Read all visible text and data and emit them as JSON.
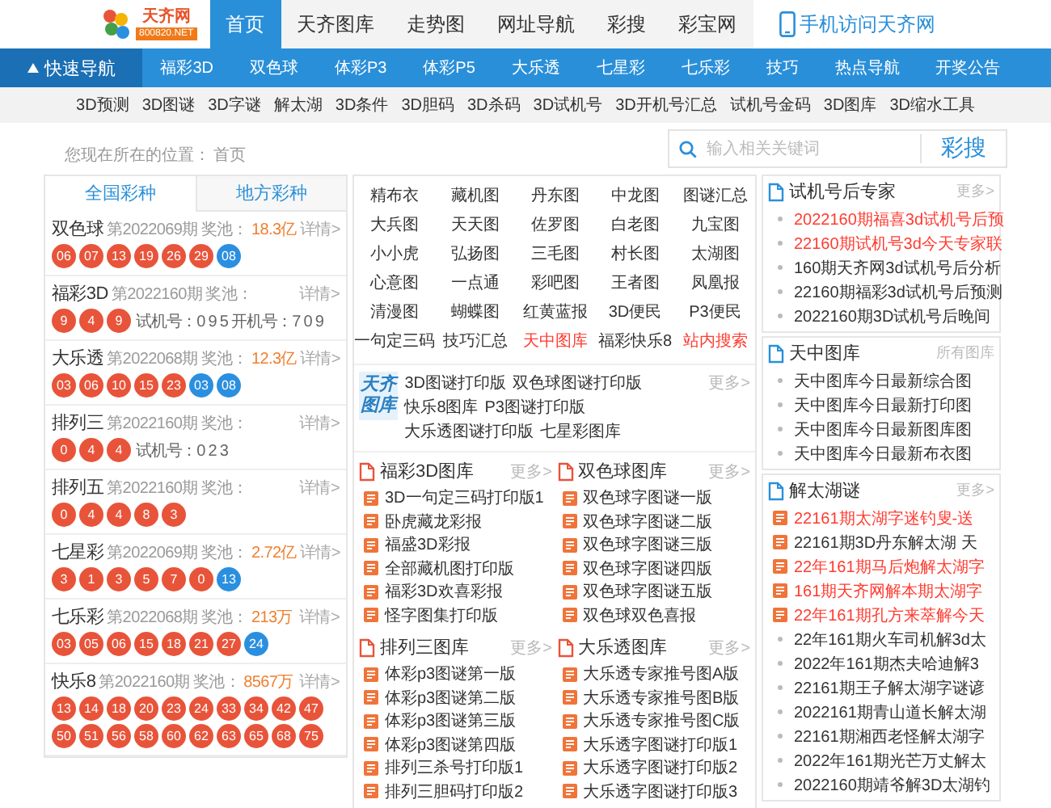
{
  "header": {
    "logo": {
      "name": "天齐网",
      "domain": "800820.NET"
    },
    "tabs": [
      {
        "label": "首页",
        "selected": true
      },
      {
        "label": "天齐图库",
        "selected": false
      },
      {
        "label": "走势图",
        "selected": false
      },
      {
        "label": "网址导航",
        "selected": false
      },
      {
        "label": "彩搜",
        "selected": false
      },
      {
        "label": "彩宝网",
        "selected": false
      }
    ],
    "mobile_link": "手机访问天齐网"
  },
  "quick_nav": {
    "label": "快速导航",
    "items": [
      "福彩3D",
      "双色球",
      "体彩P3",
      "体彩P5",
      "大乐透",
      "七星彩",
      "七乐彩",
      "技巧",
      "热点导航",
      "开奖公告"
    ]
  },
  "sub_nav": [
    "3D预测",
    "3D图谜",
    "3D字谜",
    "解太湖",
    "3D条件",
    "3D胆码",
    "3D杀码",
    "3D试机号",
    "3D开机号汇总",
    "试机号金码",
    "3D图库",
    "3D缩水工具"
  ],
  "breadcrumb": {
    "label": "您现在所在的位置：",
    "current": "首页"
  },
  "search": {
    "placeholder": "输入相关关键词",
    "button": "彩搜"
  },
  "lottery_tabs": [
    {
      "label": "全国彩种",
      "selected": true
    },
    {
      "label": "地方彩种",
      "selected": false
    }
  ],
  "lotteries": [
    {
      "name": "双色球",
      "issue": "第2022069期",
      "pool_label": "奖池：",
      "pool": "18.3亿",
      "detail": "详情>",
      "balls": [
        {
          "n": "06",
          "color": "#e8543a"
        },
        {
          "n": "07",
          "color": "#e8543a"
        },
        {
          "n": "13",
          "color": "#e8543a"
        },
        {
          "n": "19",
          "color": "#e8543a"
        },
        {
          "n": "26",
          "color": "#e8543a"
        },
        {
          "n": "29",
          "color": "#e8543a"
        },
        {
          "n": "08",
          "color": "#2b8fe0"
        }
      ]
    },
    {
      "name": "福彩3D",
      "issue": "第2022160期",
      "pool_label": "奖池：",
      "detail": "详情>",
      "balls": [
        {
          "n": "9",
          "color": "#e8543a"
        },
        {
          "n": "4",
          "color": "#e8543a"
        },
        {
          "n": "9",
          "color": "#e8543a"
        }
      ],
      "extra": "试机号：0 9 5 开机号：7 0 9"
    },
    {
      "name": "大乐透",
      "issue": "第2022068期",
      "pool_label": "奖池：",
      "pool": "12.3亿",
      "detail": "详情>",
      "balls": [
        {
          "n": "03",
          "color": "#e8543a"
        },
        {
          "n": "06",
          "color": "#e8543a"
        },
        {
          "n": "10",
          "color": "#e8543a"
        },
        {
          "n": "15",
          "color": "#e8543a"
        },
        {
          "n": "23",
          "color": "#e8543a"
        },
        {
          "n": "03",
          "color": "#2b8fe0"
        },
        {
          "n": "08",
          "color": "#2b8fe0"
        }
      ]
    },
    {
      "name": "排列三",
      "issue": "第2022160期",
      "pool_label": "奖池：",
      "detail": "详情>",
      "balls": [
        {
          "n": "0",
          "color": "#e8543a"
        },
        {
          "n": "4",
          "color": "#e8543a"
        },
        {
          "n": "4",
          "color": "#e8543a"
        }
      ],
      "extra": "试机号：0 2 3"
    },
    {
      "name": "排列五",
      "issue": "第2022160期",
      "pool_label": "奖池：",
      "detail": "详情>",
      "balls": [
        {
          "n": "0",
          "color": "#e8543a"
        },
        {
          "n": "4",
          "color": "#e8543a"
        },
        {
          "n": "4",
          "color": "#e8543a"
        },
        {
          "n": "8",
          "color": "#e8543a"
        },
        {
          "n": "3",
          "color": "#e8543a"
        }
      ]
    },
    {
      "name": "七星彩",
      "issue": "第2022069期",
      "pool_label": "奖池：",
      "pool": "2.72亿",
      "detail": "详情>",
      "balls": [
        {
          "n": "3",
          "color": "#e8543a"
        },
        {
          "n": "1",
          "color": "#e8543a"
        },
        {
          "n": "3",
          "color": "#e8543a"
        },
        {
          "n": "5",
          "color": "#e8543a"
        },
        {
          "n": "7",
          "color": "#e8543a"
        },
        {
          "n": "0",
          "color": "#e8543a"
        },
        {
          "n": "13",
          "color": "#2b8fe0"
        }
      ]
    },
    {
      "name": "七乐彩",
      "issue": "第2022068期",
      "pool_label": "奖池：",
      "pool": "213万",
      "detail": "详情>",
      "balls": [
        {
          "n": "03",
          "color": "#e8543a"
        },
        {
          "n": "05",
          "color": "#e8543a"
        },
        {
          "n": "06",
          "color": "#e8543a"
        },
        {
          "n": "15",
          "color": "#e8543a"
        },
        {
          "n": "18",
          "color": "#e8543a"
        },
        {
          "n": "21",
          "color": "#e8543a"
        },
        {
          "n": "27",
          "color": "#e8543a"
        },
        {
          "n": "24",
          "color": "#2b8fe0"
        }
      ]
    },
    {
      "name": "快乐8",
      "issue": "第2022160期",
      "pool_label": "奖池：",
      "pool": "8567万",
      "detail": "详情>",
      "balls": [
        {
          "n": "13",
          "color": "#e8543a"
        },
        {
          "n": "14",
          "color": "#e8543a"
        },
        {
          "n": "18",
          "color": "#e8543a"
        },
        {
          "n": "20",
          "color": "#e8543a"
        },
        {
          "n": "23",
          "color": "#e8543a"
        },
        {
          "n": "24",
          "color": "#e8543a"
        },
        {
          "n": "33",
          "color": "#e8543a"
        },
        {
          "n": "34",
          "color": "#e8543a"
        },
        {
          "n": "42",
          "color": "#e8543a"
        },
        {
          "n": "47",
          "color": "#e8543a"
        },
        {
          "n": "50",
          "color": "#e8543a"
        },
        {
          "n": "51",
          "color": "#e8543a"
        },
        {
          "n": "56",
          "color": "#e8543a"
        },
        {
          "n": "58",
          "color": "#e8543a"
        },
        {
          "n": "60",
          "color": "#e8543a"
        },
        {
          "n": "62",
          "color": "#e8543a"
        },
        {
          "n": "63",
          "color": "#e8543a"
        },
        {
          "n": "65",
          "color": "#e8543a"
        },
        {
          "n": "68",
          "color": "#e8543a"
        },
        {
          "n": "75",
          "color": "#e8543a"
        }
      ]
    }
  ],
  "gallery_links": [
    {
      "label": "精布衣",
      "highlight": false
    },
    {
      "label": "藏机图",
      "highlight": false
    },
    {
      "label": "丹东图",
      "highlight": false
    },
    {
      "label": "中龙图",
      "highlight": false
    },
    {
      "label": "图谜汇总",
      "highlight": false
    },
    {
      "label": "大兵图",
      "highlight": false
    },
    {
      "label": "天天图",
      "highlight": false
    },
    {
      "label": "佐罗图",
      "highlight": false
    },
    {
      "label": "白老图",
      "highlight": false
    },
    {
      "label": "九宝图",
      "highlight": false
    },
    {
      "label": "小小虎",
      "highlight": false
    },
    {
      "label": "弘扬图",
      "highlight": false
    },
    {
      "label": "三毛图",
      "highlight": false
    },
    {
      "label": "村长图",
      "highlight": false
    },
    {
      "label": "太湖图",
      "highlight": false
    },
    {
      "label": "心意图",
      "highlight": false
    },
    {
      "label": "一点通",
      "highlight": false
    },
    {
      "label": "彩吧图",
      "highlight": false
    },
    {
      "label": "王者图",
      "highlight": false
    },
    {
      "label": "凤凰报",
      "highlight": false
    },
    {
      "label": "清漫图",
      "highlight": false
    },
    {
      "label": "蝴蝶图",
      "highlight": false
    },
    {
      "label": "红黄蓝报",
      "highlight": false
    },
    {
      "label": "3D便民",
      "highlight": false
    },
    {
      "label": "P3便民",
      "highlight": false
    },
    {
      "label": "一句定三码",
      "highlight": false
    },
    {
      "label": "技巧汇总",
      "highlight": false
    },
    {
      "label": "天中图库",
      "highlight": true
    },
    {
      "label": "福彩快乐8",
      "highlight": false
    },
    {
      "label": "站内搜索",
      "highlight": true
    }
  ],
  "print_banner": {
    "logo": "天齐图库",
    "links": [
      "3D图谜打印版",
      "双色球图谜打印版",
      "快乐8图库",
      "P3图谜打印版",
      "大乐透图谜打印版",
      "七星彩图库"
    ],
    "more": "更多>"
  },
  "libraries": [
    {
      "title": "福彩3D图库",
      "more": "更多>",
      "items": [
        "3D一句定三码打印版1",
        "卧虎藏龙彩报",
        "福盛3D彩报",
        "全部藏机图打印版",
        "福彩3D欢喜彩报",
        "怪字图集打印版"
      ]
    },
    {
      "title": "双色球图库",
      "more": "更多>",
      "items": [
        "双色球字图谜一版",
        "双色球字图谜二版",
        "双色球字图谜三版",
        "双色球字图谜四版",
        "双色球字图谜五版",
        "双色球双色喜报"
      ]
    },
    {
      "title": "排列三图库",
      "more": "更多>",
      "items": [
        "体彩p3图谜第一版",
        "体彩p3图谜第二版",
        "体彩p3图谜第三版",
        "体彩p3图谜第四版",
        "排列三杀号打印版1",
        "排列三胆码打印版2"
      ]
    },
    {
      "title": "大乐透图库",
      "more": "更多>",
      "items": [
        "大乐透专家推号图A版",
        "大乐透专家推号图B版",
        "大乐透专家推号图C版",
        "大乐透字图谜打印版1",
        "大乐透字图谜打印版2",
        "大乐透字图谜打印版3"
      ]
    }
  ],
  "side_sections": [
    {
      "title": "试机号后专家",
      "more": "更多>",
      "items": [
        {
          "label": "2022160期福喜3d试机号后预",
          "kind": "dot",
          "highlight": true
        },
        {
          "label": "22160期试机号3d今天专家联",
          "kind": "dot",
          "highlight": true
        },
        {
          "label": "160期天齐网3d试机号后分析",
          "kind": "dot",
          "highlight": false
        },
        {
          "label": "22160期福彩3d试机号后预测",
          "kind": "dot",
          "highlight": false
        },
        {
          "label": "2022160期3D试机号后晚间",
          "kind": "dot",
          "highlight": false
        }
      ]
    },
    {
      "title": "天中图库",
      "more": "所有图库",
      "items": [
        {
          "label": "天中图库今日最新综合图",
          "kind": "dot",
          "highlight": false
        },
        {
          "label": "天中图库今日最新打印图",
          "kind": "dot",
          "highlight": false
        },
        {
          "label": "天中图库今日最新图库图",
          "kind": "dot",
          "highlight": false
        },
        {
          "label": "天中图库今日最新布衣图",
          "kind": "dot",
          "highlight": false
        }
      ]
    },
    {
      "title": "解太湖谜",
      "more": "更多>",
      "items": [
        {
          "label": "22161期太湖字迷钓叟-送",
          "kind": "badge",
          "highlight": true
        },
        {
          "label": "22161期3D丹东解太湖 天",
          "kind": "badge",
          "highlight": false
        },
        {
          "label": "22年161期马后炮解太湖字",
          "kind": "badge",
          "highlight": true
        },
        {
          "label": "161期天齐网解本期太湖字",
          "kind": "badge",
          "highlight": true
        },
        {
          "label": "22年161期孔方来萃解今天",
          "kind": "badge",
          "highlight": true
        },
        {
          "label": "22年161期火车司机解3d太",
          "kind": "dot",
          "highlight": false
        },
        {
          "label": "2022年161期杰夫哈迪解3",
          "kind": "dot",
          "highlight": false
        },
        {
          "label": "22161期王子解太湖字谜谚",
          "kind": "dot",
          "highlight": false
        },
        {
          "label": "2022161期青山道长解太湖",
          "kind": "dot",
          "highlight": false
        },
        {
          "label": "22161期湘西老怪解太湖字",
          "kind": "dot",
          "highlight": false
        },
        {
          "label": "2022年161期光芒万丈解太",
          "kind": "dot",
          "highlight": false
        },
        {
          "label": "2022160期靖爷解3D太湖钓",
          "kind": "dot",
          "highlight": false
        }
      ]
    }
  ]
}
